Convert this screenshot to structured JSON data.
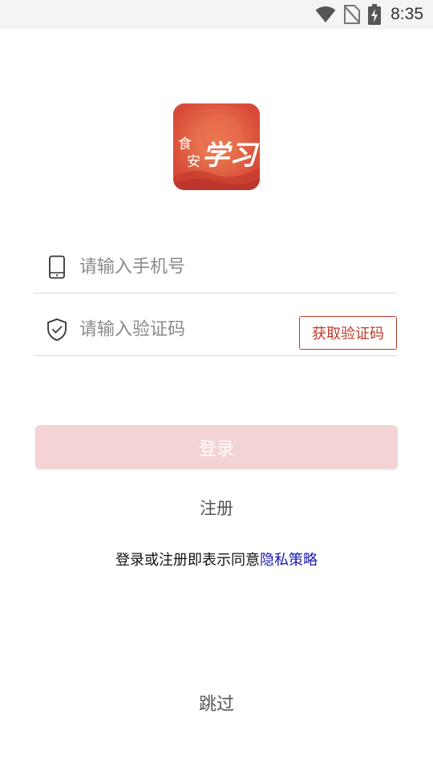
{
  "status_bar": {
    "time": "8:35",
    "icons": [
      "wifi-icon",
      "no-sim-icon",
      "battery-charging-icon"
    ]
  },
  "logo": {
    "text_small_top": "食",
    "text_small_bottom": "安",
    "text_large": "学习",
    "colors": {
      "background": "#d84a38",
      "text": "#ffffff"
    }
  },
  "form": {
    "phone": {
      "placeholder": "请输入手机号",
      "value": "",
      "icon": "phone-icon"
    },
    "code": {
      "placeholder": "请输入验证码",
      "value": "",
      "icon": "shield-check-icon"
    },
    "get_code_label": "获取验证码"
  },
  "actions": {
    "login_label": "登录",
    "register_label": "注册",
    "skip_label": "跳过"
  },
  "agreement": {
    "prefix": "登录或注册即表示同意",
    "link": "隐私策略"
  },
  "colors": {
    "accent": "#c0392b",
    "login_disabled_bg": "#f3d3d3",
    "link": "#1b1baa"
  }
}
